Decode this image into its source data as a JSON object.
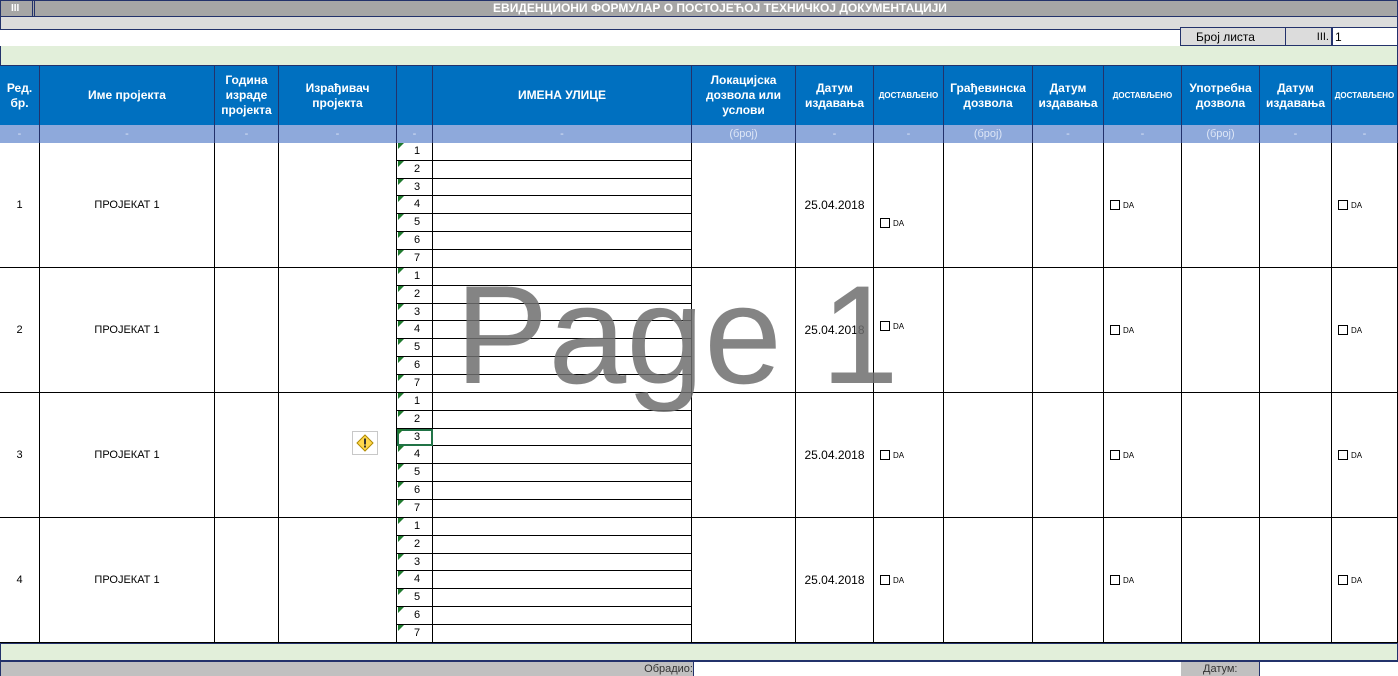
{
  "title_section": "III",
  "title": "ЕВИДЕНЦИОНИ ФОРМУЛАР О ПОСТОЈЕЋОЈ ТЕХНИЧКОЈ ДОКУМЕНТАЦИЈИ",
  "sheet": {
    "label": "Број листа",
    "section": "III.",
    "value": "1"
  },
  "headers": [
    "Ред. бр.",
    "Име пројекта",
    "Година израде пројекта",
    "Израђивач пројекта",
    "",
    "ИМЕНА УЛИЦЕ",
    "Локацијска дозвола или услови",
    "Датум издавања",
    "ДОСТАВЉЕНО",
    "Грађевинска дозвола",
    "Датум издавања",
    "ДОСТАВЉЕНО",
    "Употребна дозвола",
    "Датум издавања",
    "ДОСТАВЉЕНО"
  ],
  "subheaders": [
    "-",
    "-",
    "-",
    "-",
    "-",
    "-",
    "(број)",
    "-",
    "-",
    "(број)",
    "-",
    "-",
    "(број)",
    "-",
    "-"
  ],
  "rows": [
    {
      "num": "1",
      "name": "ПРОЈЕКАТ 1",
      "date": "25.04.2018",
      "da1": "DA",
      "da2": "DA",
      "da3": "DA"
    },
    {
      "num": "2",
      "name": "ПРОЈЕКАТ 1",
      "date": "25.04.2018",
      "da1": "DA",
      "da2": "DA",
      "da3": "DA"
    },
    {
      "num": "3",
      "name": "ПРОЈЕКАТ 1",
      "date": "25.04.2018",
      "da1": "DA",
      "da2": "DA",
      "da3": "DA"
    },
    {
      "num": "4",
      "name": "ПРОЈЕКАТ 1",
      "date": "25.04.2018",
      "da1": "DA",
      "da2": "DA",
      "da3": "DA"
    }
  ],
  "street_numbers": [
    "1",
    "2",
    "3",
    "4",
    "5",
    "6",
    "7"
  ],
  "watermark": "Page 1",
  "footer": {
    "processed_label": "Обрадио:",
    "date_label": "Датум:"
  },
  "colors": {
    "header_blue": "#0070c0",
    "subheader_blue": "#8ea9db",
    "light_green": "#e2efda",
    "title_gray": "#a6a6a6"
  },
  "icons": {
    "warning": "warning-diamond-icon",
    "checkbox": "checkbox-icon"
  }
}
